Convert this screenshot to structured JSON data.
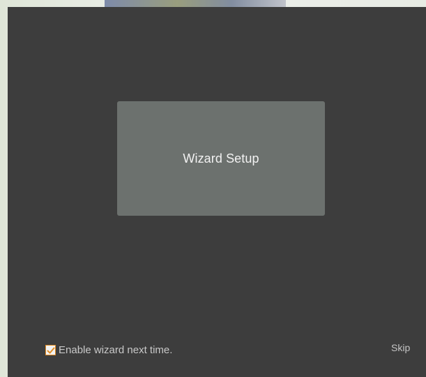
{
  "wizard": {
    "tile_label": "Wizard Setup"
  },
  "footer": {
    "enable_wizard_label": "Enable wizard next time.",
    "enable_wizard_checked": true,
    "skip_label": "Skip"
  },
  "colors": {
    "dialog_background": "#3d3d3d",
    "tile_background": "#6c716e",
    "checkbox_accent": "#e38c22"
  },
  "icons": {
    "checkbox": "check-icon"
  }
}
